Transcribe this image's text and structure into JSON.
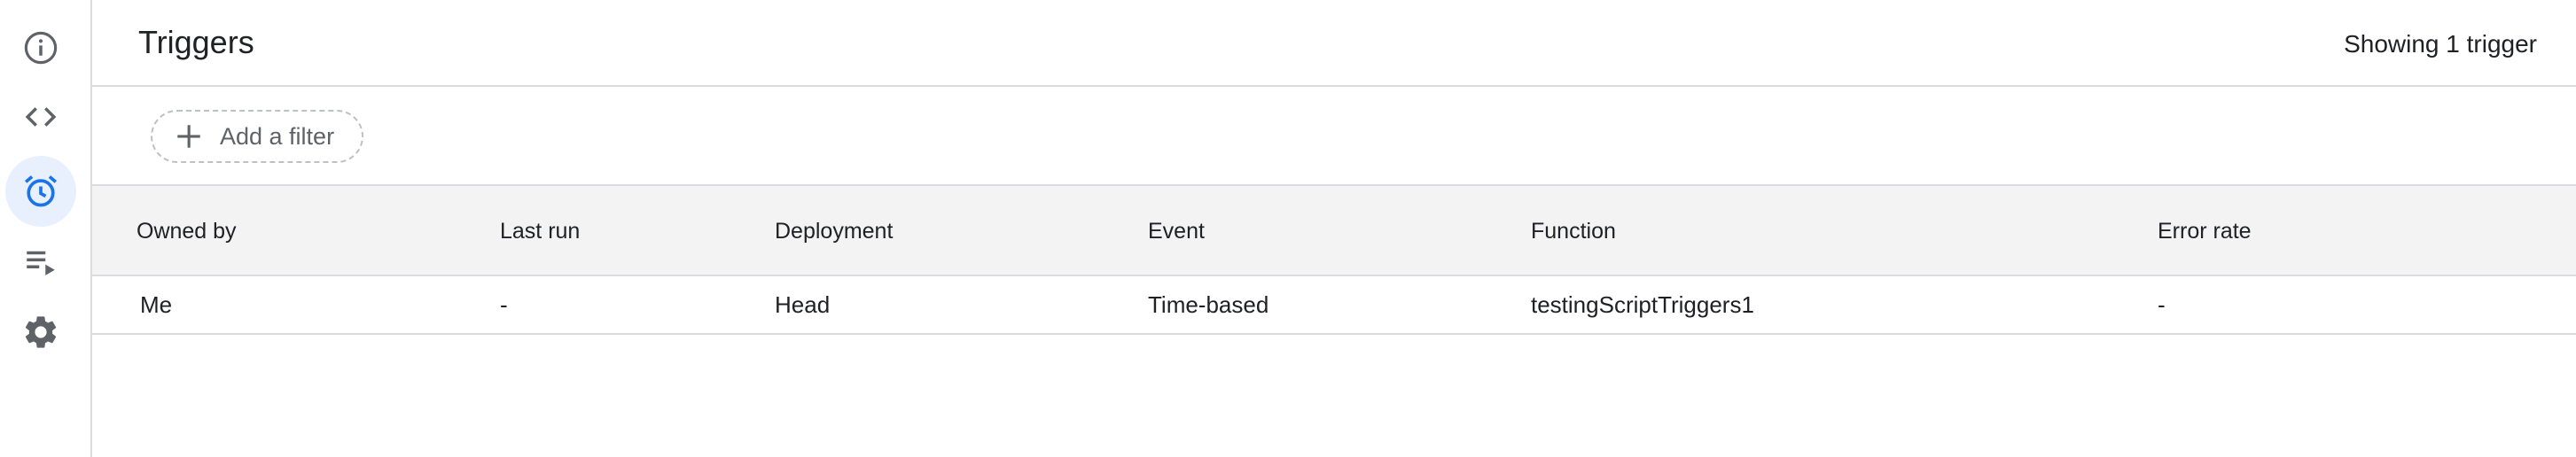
{
  "nav": {
    "items": [
      {
        "id": "overview",
        "icon": "info-icon",
        "active": false
      },
      {
        "id": "editor",
        "icon": "code-icon",
        "active": false
      },
      {
        "id": "triggers",
        "icon": "alarm-clock-icon",
        "active": true
      },
      {
        "id": "executions",
        "icon": "playlist-play-icon",
        "active": false
      },
      {
        "id": "settings",
        "icon": "gear-icon",
        "active": false
      }
    ]
  },
  "header": {
    "title": "Triggers",
    "count_text": "Showing 1 trigger"
  },
  "filter": {
    "add_label": "Add a filter"
  },
  "table": {
    "columns": [
      "Owned by",
      "Last run",
      "Deployment",
      "Event",
      "Function",
      "Error rate"
    ],
    "rows": [
      {
        "owned_by": "Me",
        "last_run": "-",
        "deployment": "Head",
        "event": "Time-based",
        "function": "testingScriptTriggers1",
        "error_rate": "-"
      }
    ]
  },
  "colors": {
    "accent": "#1a73e8",
    "active_bg": "#e8f0fe",
    "icon": "#5f6368",
    "header_bg": "#f3f3f3",
    "divider": "#dadce0"
  }
}
